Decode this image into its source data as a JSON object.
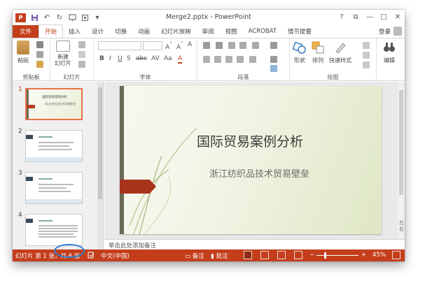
{
  "window": {
    "title": "Merge2.pptx - PowerPoint",
    "app_icon_text": "P"
  },
  "quick_access": [
    "save-icon",
    "undo-icon",
    "redo-icon",
    "presentation-start-icon",
    "touch-mode-icon",
    "customize-icon"
  ],
  "window_controls": [
    "?",
    "⧉",
    "—",
    "□",
    "✕"
  ],
  "tabs": [
    "文件",
    "开始",
    "插入",
    "设计",
    "切换",
    "动画",
    "幻灯片放映",
    "审阅",
    "视图",
    "ACROBAT",
    "情节提要"
  ],
  "active_tab": "开始",
  "account": {
    "label": "登录"
  },
  "ribbon": {
    "clipboard": {
      "label": "剪贴板",
      "paste": "粘贴"
    },
    "slides": {
      "label": "幻灯片",
      "new_slide": "新建\n幻灯片"
    },
    "font": {
      "label": "字体",
      "format_buttons": [
        "B",
        "I",
        "U",
        "S",
        "abc",
        "AV",
        "Aa",
        "A"
      ]
    },
    "paragraph": {
      "label": "段落"
    },
    "drawing": {
      "label": "绘图",
      "shapes": "形状",
      "arrange": "排列",
      "quick_styles": "快速样式"
    },
    "editing": {
      "label": "编辑",
      "button": "编辑"
    }
  },
  "thumbnails": [
    {
      "number": "1",
      "title": "国际贸易案例分析",
      "subtitle": "浙江纺织品技术贸易壁垒",
      "selected": true
    },
    {
      "number": "2",
      "title": "",
      "subtitle": "",
      "selected": false
    },
    {
      "number": "3",
      "title": "",
      "subtitle": "",
      "selected": false
    },
    {
      "number": "4",
      "title": "",
      "subtitle": "",
      "selected": false
    }
  ],
  "slide": {
    "title": "国际贸易案例分析",
    "subtitle": "浙江纺织品技术贸易壁垒",
    "colors": {
      "strip": "#6b6a58",
      "accent": "#a8341c"
    }
  },
  "side_text": "左 右",
  "notes_placeholder": "单击此处添加备注",
  "status": {
    "slide_position": "幻灯片 第 1 张，共 6 张",
    "language": "中文(中国)",
    "notes_button": "备注",
    "comments_button": "批注",
    "zoom_minus": "−",
    "zoom_plus": "+",
    "zoom_level": "45%",
    "zoom_fraction": 0.45
  },
  "colors": {
    "accent": "#c43e1c",
    "highlight_circle": "#2f7fd1"
  }
}
